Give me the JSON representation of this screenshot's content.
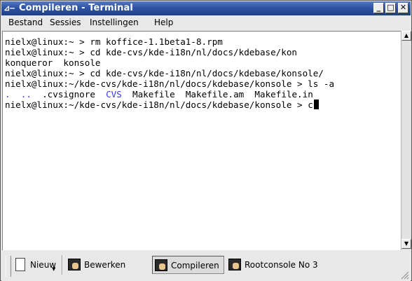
{
  "window": {
    "title": "Compileren - Terminal",
    "menu_icon": "⊿–",
    "buttons": {
      "minimize": "_",
      "maximize": "□",
      "close": "✕"
    }
  },
  "menubar": {
    "items": [
      "Bestand",
      "Sessies",
      "Instellingen",
      "Help"
    ]
  },
  "terminal": {
    "lines": [
      "nielx@linux:~ > rm koffice-1.1beta1-8.rpm",
      "nielx@linux:~ > cd kde-cvs/kde-i18n/nl/docs/kdebase/kon",
      "konqueror  konsole",
      "nielx@linux:~ > cd kde-cvs/kde-i18n/nl/docs/kdebase/konsole/",
      "nielx@linux:~/kde-cvs/kde-i18n/nl/docs/kdebase/konsole > ls -a"
    ],
    "ls_output": {
      "dots": ".  ..",
      "cvsignore": ".cvsignore",
      "cvs_dir": "CVS",
      "files": "Makefile  Makefile.am  Makefile.in"
    },
    "current_prompt": "nielx@linux:~/kde-cvs/kde-i18n/nl/docs/kdebase/konsole > ",
    "current_input": "c",
    "colors": {
      "directory": "#3a3ae8",
      "background": "#ffffff",
      "text": "#000000"
    }
  },
  "scrollbar": {
    "up_icon": "▲",
    "down_icon": "▼"
  },
  "taskbar": {
    "new_button": "Nieuw",
    "tabs": [
      "Bewerken",
      "Compileren",
      "Rootconsole No 3"
    ],
    "active_tab": "Compileren"
  },
  "colors": {
    "titlebar": "#2f54a5"
  }
}
